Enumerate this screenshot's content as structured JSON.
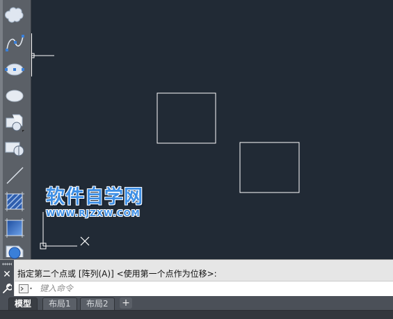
{
  "toolbar": {
    "tools": [
      {
        "name": "revision-cloud-icon"
      },
      {
        "name": "spline-icon"
      },
      {
        "name": "ellipse-icon"
      },
      {
        "name": "ellipse-arc-icon"
      },
      {
        "name": "insert-block-icon"
      },
      {
        "name": "create-block-icon"
      },
      {
        "name": "point-icon"
      },
      {
        "name": "hatch-icon"
      },
      {
        "name": "gradient-icon"
      },
      {
        "name": "region-icon"
      }
    ]
  },
  "watermark": {
    "title": "软件自学网",
    "url": "WWW.RJZXW.COM"
  },
  "command_line": {
    "history": "指定第二个点或 [阵列(A)] <使用第一个点作为位移>:",
    "input_placeholder": "键入命令",
    "close_glyph": "✕"
  },
  "layout_tabs": {
    "tabs": [
      "模型",
      "布局1",
      "布局2"
    ],
    "active_tab": "模型",
    "add_glyph": "+"
  },
  "colors": {
    "canvas_background": "#212a35",
    "drawing_lines": "#ffffff",
    "watermark_blue": "#3e8fe5",
    "toolbar_background": "#5b6067"
  }
}
